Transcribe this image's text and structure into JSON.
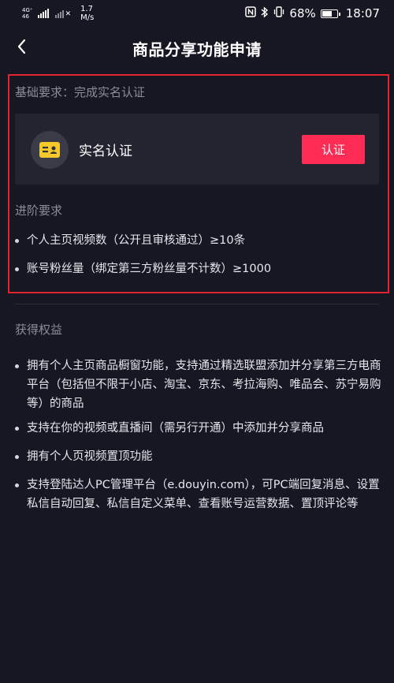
{
  "status_bar": {
    "network_type_top": "4G⁺",
    "network_type_bottom": "46",
    "speed_value": "1.7",
    "speed_unit": "M/s",
    "battery": "68%",
    "time": "18:07"
  },
  "nav": {
    "title": "商品分享功能申请"
  },
  "requirements": {
    "basic_label": "基础要求：完成实名认证",
    "card_title": "实名认证",
    "verify_button": "认证",
    "advanced_label": "进阶要求",
    "advanced_items": [
      "个人主页视频数（公开且审核通过）≥10条",
      "账号粉丝量（绑定第三方粉丝量不计数）≥1000"
    ]
  },
  "benefits": {
    "label": "获得权益",
    "items": [
      "拥有个人主页商品橱窗功能，支持通过精选联盟添加并分享第三方电商平台（包括但不限于小店、淘宝、京东、考拉海购、唯品会、苏宁易购等）的商品",
      "支持在你的视频或直播间（需另行开通）中添加并分享商品",
      "拥有个人页视频置顶功能",
      "支持登陆达人PC管理平台（e.douyin.com），可PC端回复消息、设置私信自动回复、私信自定义菜单、查看账号运营数据、置顶评论等"
    ]
  },
  "colors": {
    "background": "#161722",
    "accent": "#fe2c55",
    "highlight_border": "#e0232f",
    "id_card_icon": "#f6c92a"
  },
  "icons": {
    "back": "chevron-left-icon",
    "id_card": "id-card-icon",
    "nfc": "nfc-icon",
    "bluetooth": "bluetooth-icon",
    "silent": "vibrate-icon",
    "battery": "battery-icon"
  }
}
